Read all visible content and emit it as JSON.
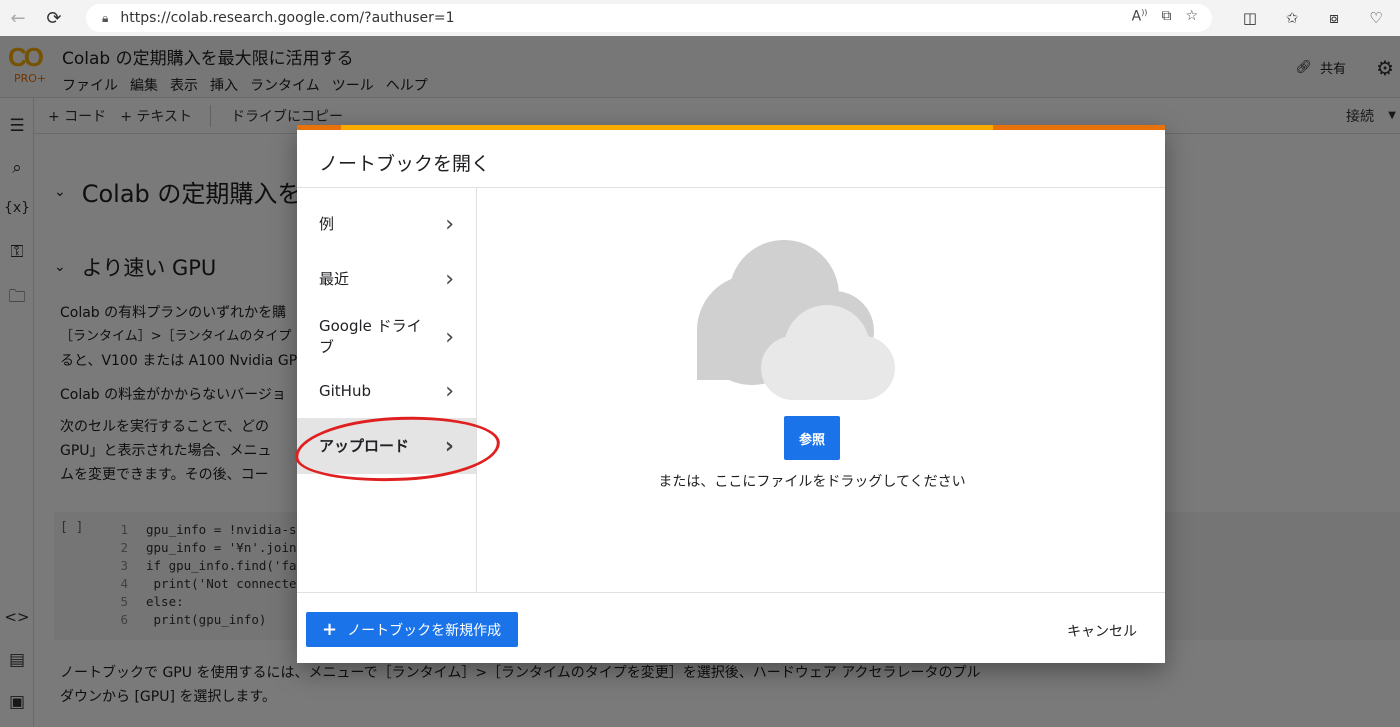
{
  "browser": {
    "url": "https://colab.research.google.com/?authuser=1"
  },
  "colab": {
    "logo": "CO",
    "plan": "PRO+",
    "title": "Colab の定期購入を最大限に活用する",
    "menu": [
      "ファイル",
      "編集",
      "表示",
      "挿入",
      "ランタイム",
      "ツール",
      "ヘルプ"
    ],
    "share_label": "共有",
    "toolbar": {
      "add_code": "+ コード",
      "add_text": "+ テキスト",
      "copy_to_drive": "ドライブにコピー",
      "connect": "接続"
    },
    "heading1": "Colab の定期購入を",
    "heading2": "より速い GPU",
    "paragraphs": [
      "Colab の有料プランのいずれかを購",
      "［ランタイム］>［ランタイムのタイプ",
      "ると、V100 または A100 Nvidia GP",
      "Colab の料金がかからないバージョ",
      "次のセルを実行することで、どの",
      "GPU」と表示された場合、メニュ",
      "ムを変更できます。その後、コー"
    ],
    "code": {
      "run_marker": "[ ]",
      "lines": [
        "gpu_info = !nvidia-smi",
        "gpu_info = '¥n'.join(gpu",
        "if gpu_info.find('failed",
        "  print('Not connected t",
        "else:",
        "  print(gpu_info)"
      ]
    },
    "footer_text": [
      "ノートブックで GPU を使用するには、メニューで［ランタイム］>［ランタイムのタイプを変更］を選択後、ハードウェア アクセラレータのプル",
      "ダウンから [GPU] を選択します。"
    ]
  },
  "dialog": {
    "title": "ノートブックを開く",
    "nav": [
      {
        "label": "例"
      },
      {
        "label": "最近"
      },
      {
        "label": "Google ドライブ"
      },
      {
        "label": "GitHub"
      },
      {
        "label": "アップロード"
      }
    ],
    "active_index": 4,
    "browse_label": "参照",
    "drag_hint": "または、ここにファイルをドラッグしてください",
    "new_notebook_label": "ノートブックを新規作成",
    "cancel_label": "キャンセル"
  },
  "colors": {
    "accent_blue": "#1a73e8",
    "colab_orange": "#f9ab00",
    "colab_dark_orange": "#e8710a",
    "annotation_red": "#e02020"
  }
}
